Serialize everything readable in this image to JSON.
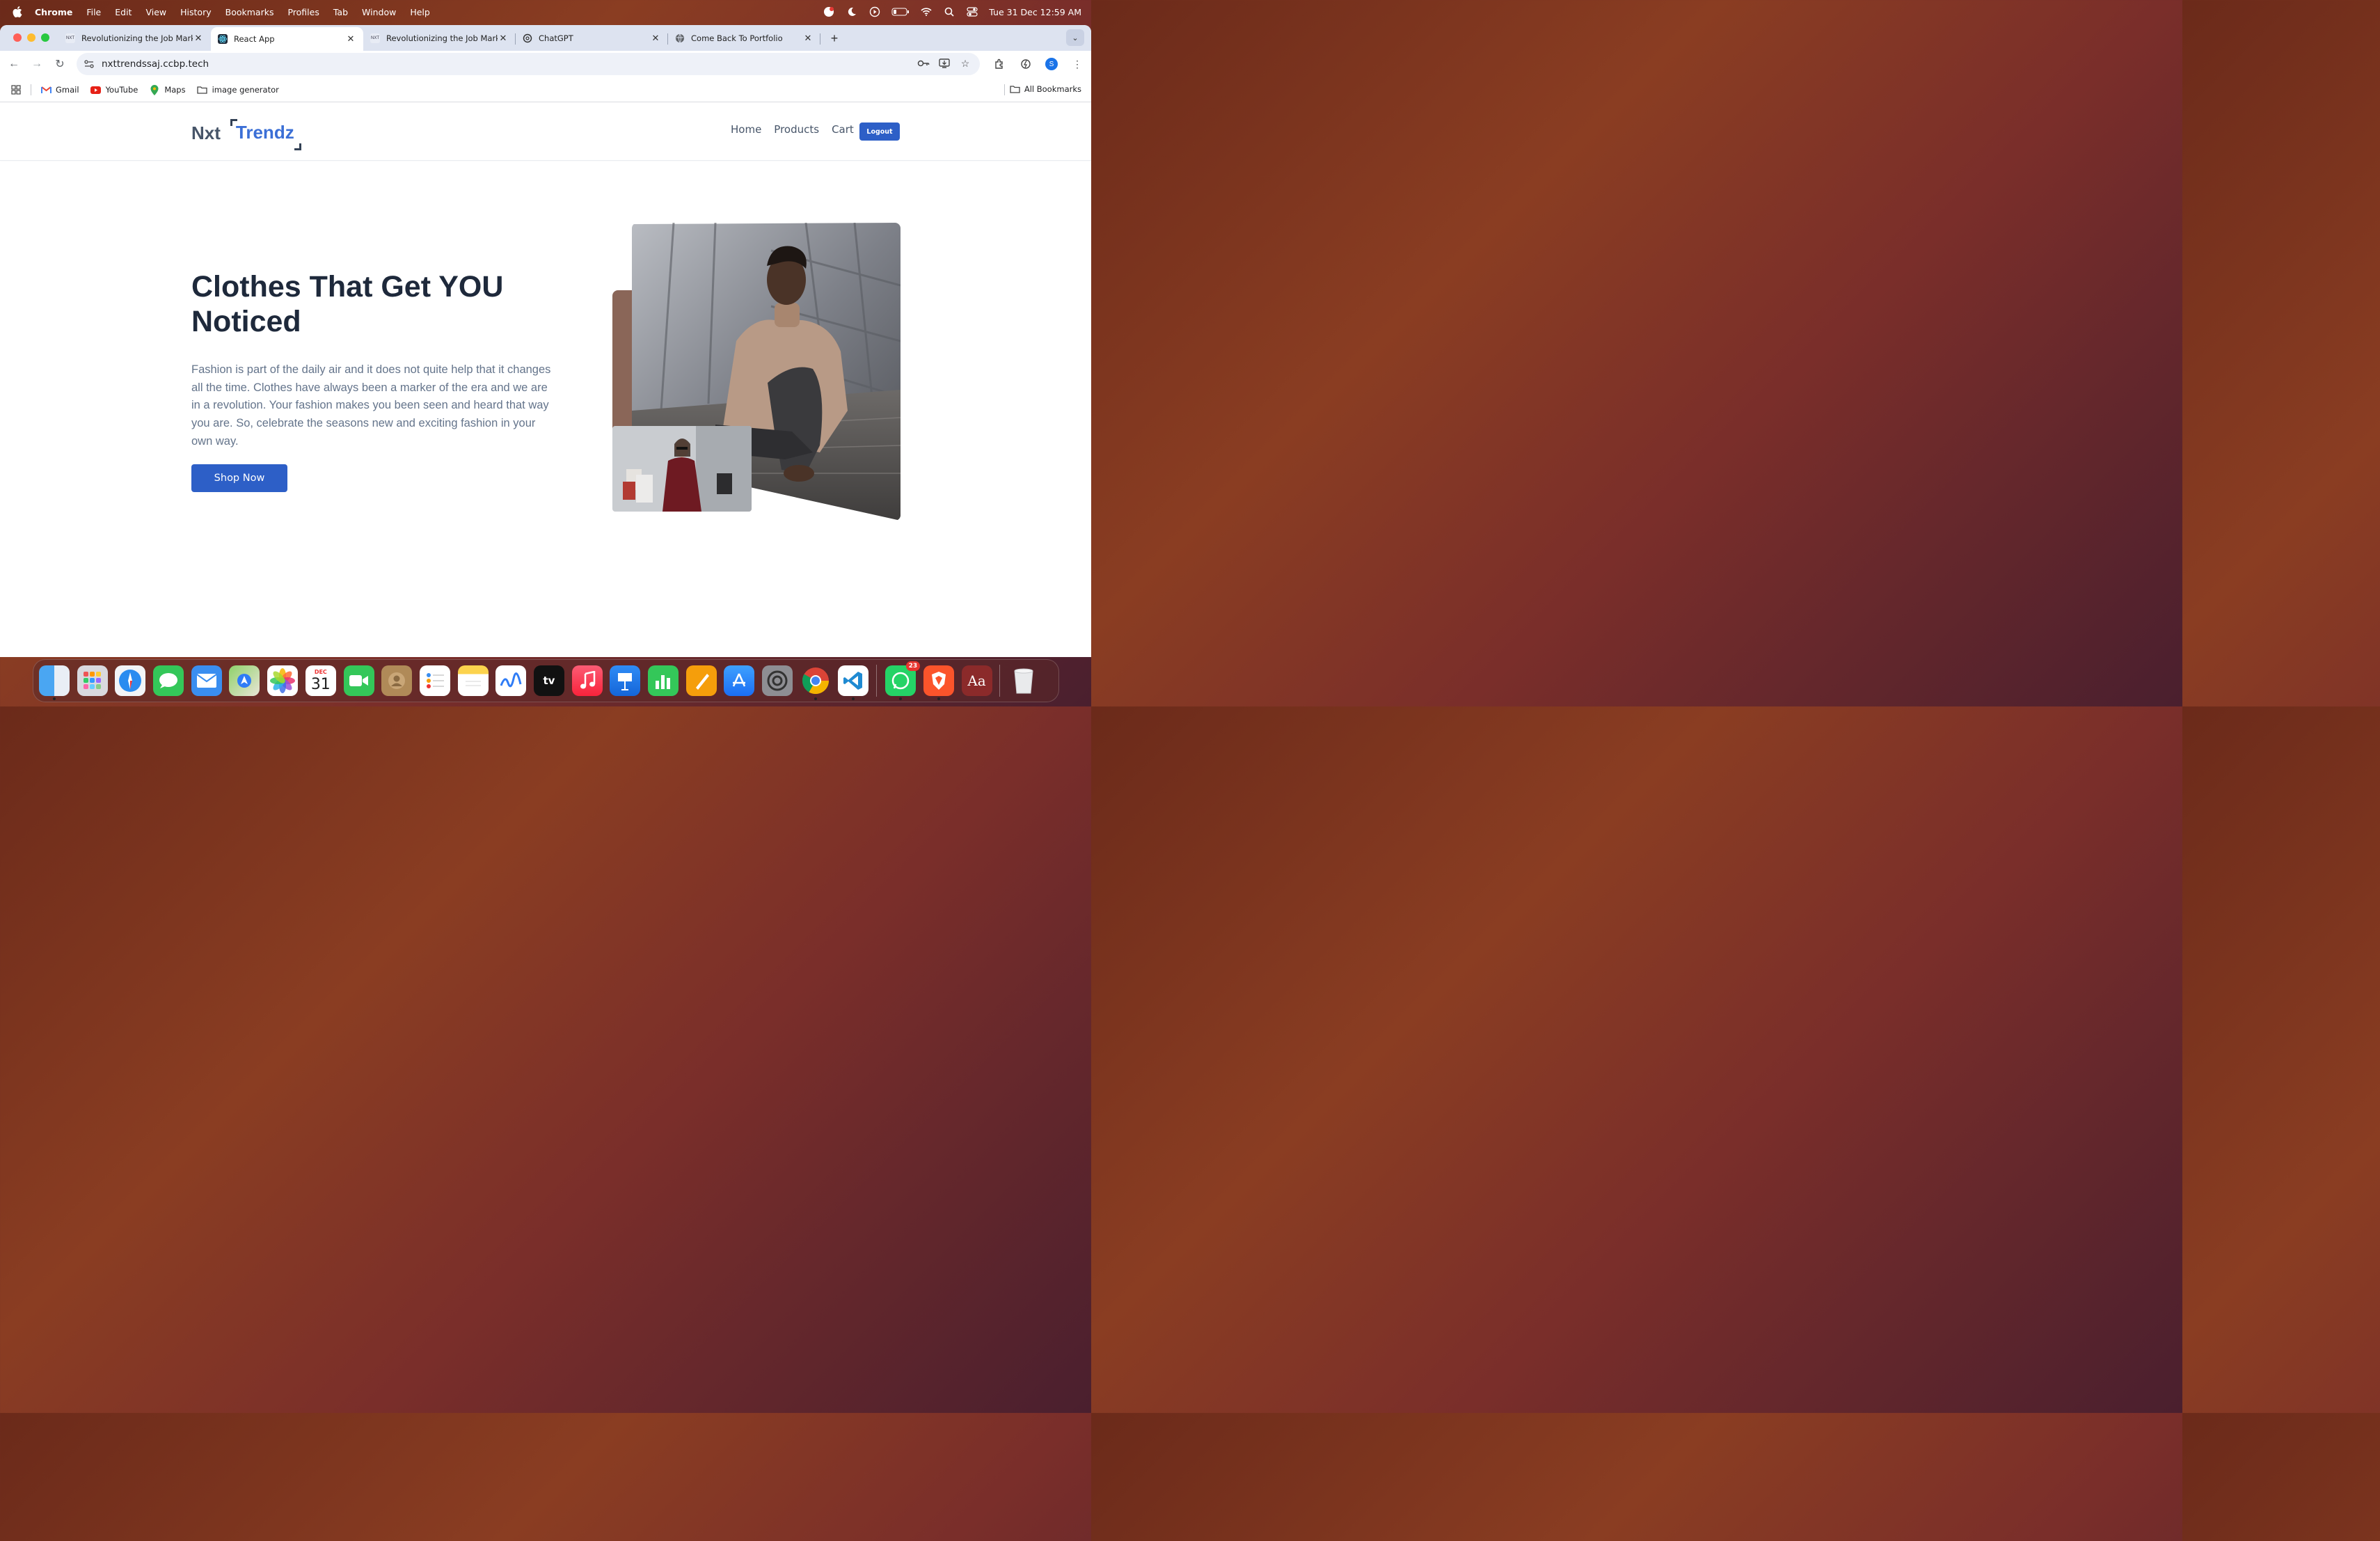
{
  "menubar": {
    "app_name": "Chrome",
    "menus": [
      "File",
      "Edit",
      "View",
      "History",
      "Bookmarks",
      "Profiles",
      "Tab",
      "Window",
      "Help"
    ],
    "datetime": "Tue 31 Dec  12:59 AM"
  },
  "tabs": [
    {
      "title": "Revolutionizing the Job Marke",
      "active": false
    },
    {
      "title": "React App",
      "active": true
    },
    {
      "title": "Revolutionizing the Job Marke",
      "active": false
    },
    {
      "title": "ChatGPT",
      "active": false
    },
    {
      "title": "Come Back To Portfolio",
      "active": false
    }
  ],
  "address_bar": {
    "url": "nxttrendssaj.ccbp.tech"
  },
  "profile_initial": "S",
  "bookmarks": {
    "items": [
      "Gmail",
      "YouTube",
      "Maps",
      "image generator"
    ],
    "all_label": "All Bookmarks"
  },
  "site": {
    "logo_prefix": "Nxt",
    "logo_word": "Trendz",
    "nav": [
      "Home",
      "Products",
      "Cart"
    ],
    "logout_label": "Logout",
    "hero_title": "Clothes That Get YOU Noticed",
    "hero_description": "Fashion is part of the daily air and it does not quite help that it changes all the time. Clothes have always been a marker of the era and we are in a revolution. Your fashion makes you been seen and heard that way you are. So, celebrate the seasons new and exciting fashion in your own way.",
    "shop_button": "Shop Now"
  },
  "dock": {
    "calendar_month": "DEC",
    "calendar_day": "31",
    "tv_label": "tv",
    "dictionary_label": "Aa",
    "whatsapp_badge": "23"
  },
  "colors": {
    "brand_blue": "#2d5fc7",
    "heading": "#1e293b",
    "body_text": "#64748b",
    "accent_brown": "#8a6658"
  }
}
